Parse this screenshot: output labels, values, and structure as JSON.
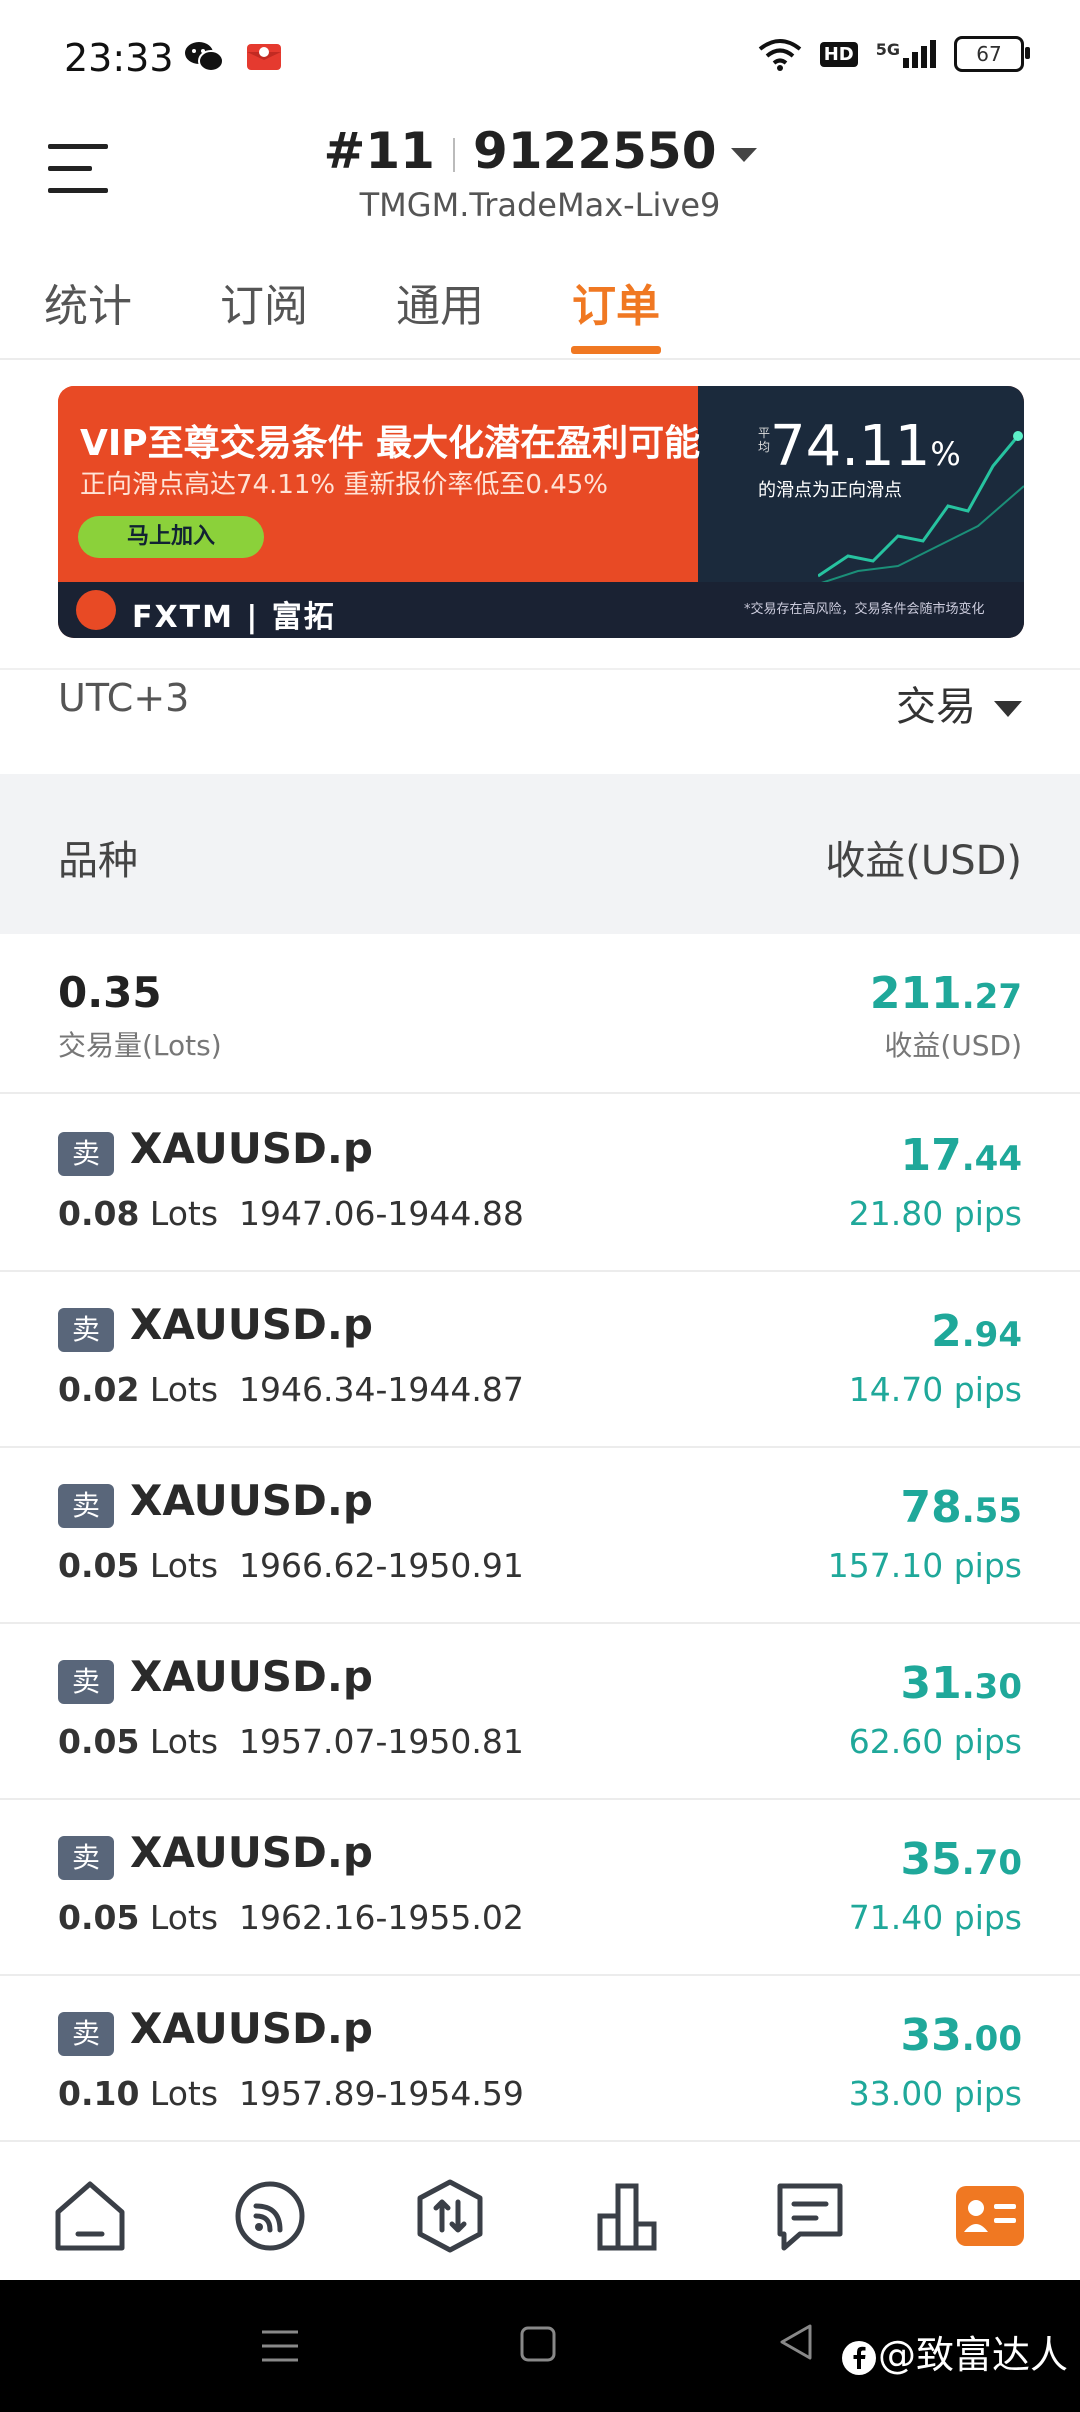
{
  "status_bar": {
    "time": "23:33",
    "battery": "67",
    "network": "5G",
    "hd": "HD"
  },
  "header": {
    "account_prefix": "#11",
    "account_number": "9122550",
    "server": "TMGM.TradeMax-Live9"
  },
  "tabs": [
    {
      "label": "统计",
      "active": false
    },
    {
      "label": "订阅",
      "active": false
    },
    {
      "label": "通用",
      "active": false
    },
    {
      "label": "订单",
      "active": true
    }
  ],
  "banner": {
    "title": "VIP至尊交易条件 最大化潜在盈利可能",
    "subtitle": "正向滑点高达74.11% 重新报价率低至0.45%",
    "button": "马上加入",
    "rate_prefix": "平均",
    "rate": "74.11",
    "rate_unit": "%",
    "rate_desc": "的滑点为正向滑点",
    "brand": "FXTM | 富拓",
    "disclaimer": "*交易存在高风险，交易条件会随市场变化"
  },
  "filter": {
    "timezone": "UTC+3",
    "type": "交易"
  },
  "columns": {
    "left": "品种",
    "right": "收益(USD)"
  },
  "summary": {
    "lots": "0.35",
    "lots_label": "交易量(Lots)",
    "profit_int": "211",
    "profit_dec": ".27",
    "profit_label": "收益(USD)"
  },
  "orders": [
    {
      "side": "卖",
      "symbol": "XAUUSD.p",
      "lots": "0.08",
      "lots_unit": "Lots",
      "prices": "1947.06-1944.88",
      "profit_int": "17",
      "profit_dec": ".44",
      "pips": "21.80 pips"
    },
    {
      "side": "卖",
      "symbol": "XAUUSD.p",
      "lots": "0.02",
      "lots_unit": "Lots",
      "prices": "1946.34-1944.87",
      "profit_int": "2",
      "profit_dec": ".94",
      "pips": "14.70 pips"
    },
    {
      "side": "卖",
      "symbol": "XAUUSD.p",
      "lots": "0.05",
      "lots_unit": "Lots",
      "prices": "1966.62-1950.91",
      "profit_int": "78",
      "profit_dec": ".55",
      "pips": "157.10 pips"
    },
    {
      "side": "卖",
      "symbol": "XAUUSD.p",
      "lots": "0.05",
      "lots_unit": "Lots",
      "prices": "1957.07-1950.81",
      "profit_int": "31",
      "profit_dec": ".30",
      "pips": "62.60 pips"
    },
    {
      "side": "卖",
      "symbol": "XAUUSD.p",
      "lots": "0.05",
      "lots_unit": "Lots",
      "prices": "1962.16-1955.02",
      "profit_int": "35",
      "profit_dec": ".70",
      "pips": "71.40 pips"
    },
    {
      "side": "卖",
      "symbol": "XAUUSD.p",
      "lots": "0.10",
      "lots_unit": "Lots",
      "prices": "1957.89-1954.59",
      "profit_int": "33",
      "profit_dec": ".00",
      "pips": "33.00 pips"
    }
  ],
  "bottom_nav": [
    {
      "icon": "home-icon",
      "active": false
    },
    {
      "icon": "signal-icon",
      "active": false
    },
    {
      "icon": "trade-icon",
      "active": false
    },
    {
      "icon": "chart-icon",
      "active": false
    },
    {
      "icon": "message-icon",
      "active": false
    },
    {
      "icon": "profile-icon",
      "active": true
    }
  ],
  "watermark": "@致富达人",
  "colors": {
    "accent": "#f07822",
    "profit": "#1fa89a",
    "badge": "#59667a"
  }
}
